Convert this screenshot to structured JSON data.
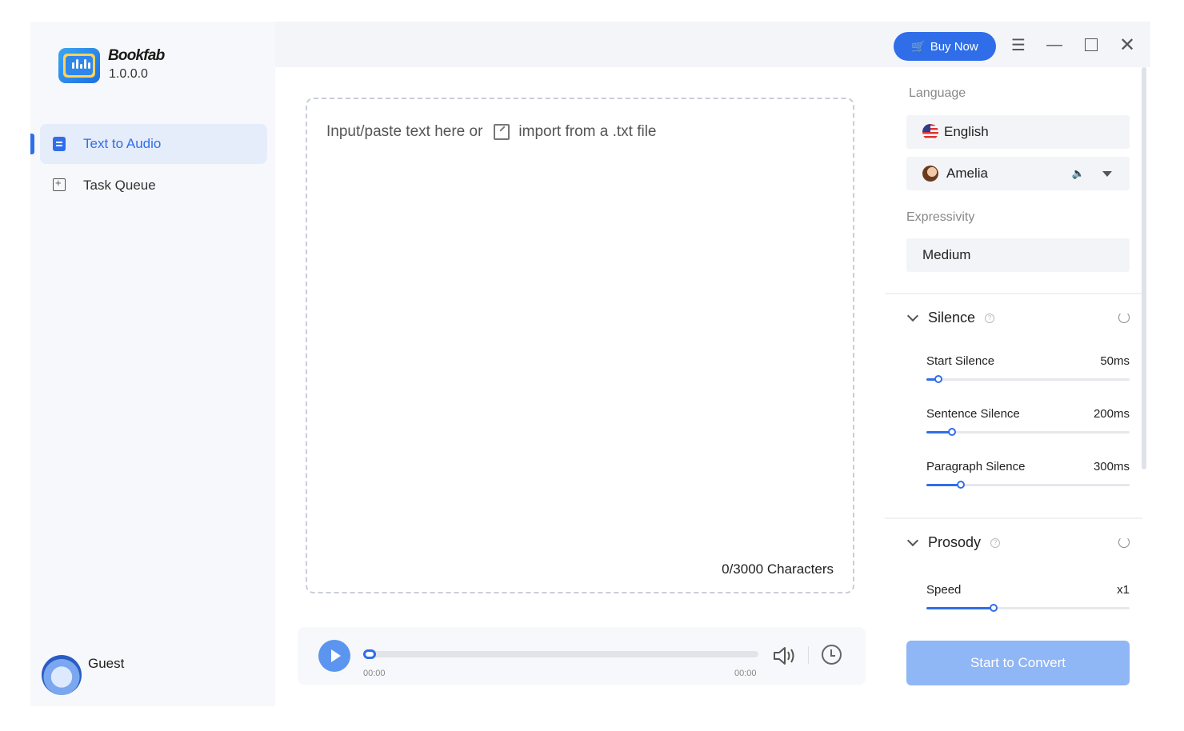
{
  "app": {
    "name": "Bookfab",
    "version": "1.0.0.0"
  },
  "sidebar": {
    "items": [
      {
        "label": "Text to Audio",
        "icon": "document-icon",
        "active": true
      },
      {
        "label": "Task Queue",
        "icon": "queue-icon",
        "active": false
      }
    ],
    "user": {
      "name": "Guest"
    }
  },
  "topbar": {
    "buy_label": "Buy Now"
  },
  "editor": {
    "placeholder_prefix": "Input/paste text here or",
    "import_label": "import from a .txt file",
    "char_count": "0/3000 Characters"
  },
  "player": {
    "time_current": "00:00",
    "time_total": "00:00",
    "progress": 0
  },
  "settings": {
    "language_label": "Language",
    "language_value": "English",
    "voice_value": "Amelia",
    "expressivity_label": "Expressivity",
    "expressivity_value": "Medium",
    "silence": {
      "title": "Silence",
      "sliders": [
        {
          "label": "Start Silence",
          "value": "50ms",
          "fraction": 0.06
        },
        {
          "label": "Sentence Silence",
          "value": "200ms",
          "fraction": 0.125
        },
        {
          "label": "Paragraph Silence",
          "value": "300ms",
          "fraction": 0.17
        }
      ]
    },
    "prosody": {
      "title": "Prosody",
      "sliders": [
        {
          "label": "Speed",
          "value": "x1",
          "fraction": 0.33
        }
      ]
    },
    "convert_label": "Start to Convert"
  },
  "colors": {
    "accent": "#2f6ee8",
    "convert_disabled": "#8fb6f5",
    "active_nav_bg": "#e5ecfa"
  }
}
